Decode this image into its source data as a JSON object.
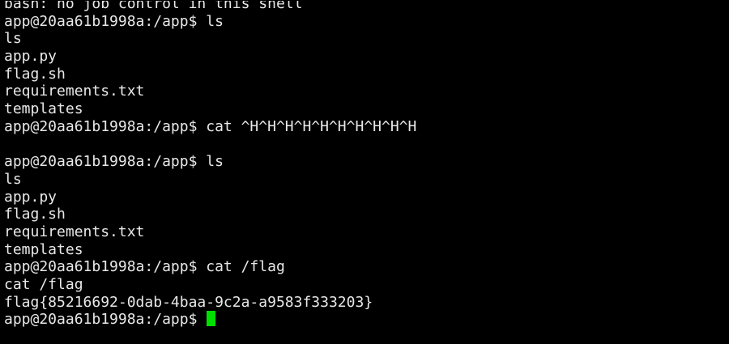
{
  "terminal": {
    "lines": [
      "bash: no job control in this shell",
      "app@20aa61b1998a:/app$ ls",
      "ls",
      "app.py",
      "flag.sh",
      "requirements.txt",
      "templates",
      "app@20aa61b1998a:/app$ cat ^H^H^H^H^H^H^H^H^H^H",
      "",
      "app@20aa61b1998a:/app$ ls",
      "ls",
      "app.py",
      "flag.sh",
      "requirements.txt",
      "templates",
      "app@20aa61b1998a:/app$ cat /flag",
      "cat /flag",
      "flag{85216692-0dab-4baa-9c2a-a9583f333203}"
    ],
    "prompt": "app@20aa61b1998a:/app$ ",
    "colors": {
      "background": "#000000",
      "text": "#e8e8e8",
      "cursor": "#00e000"
    }
  }
}
